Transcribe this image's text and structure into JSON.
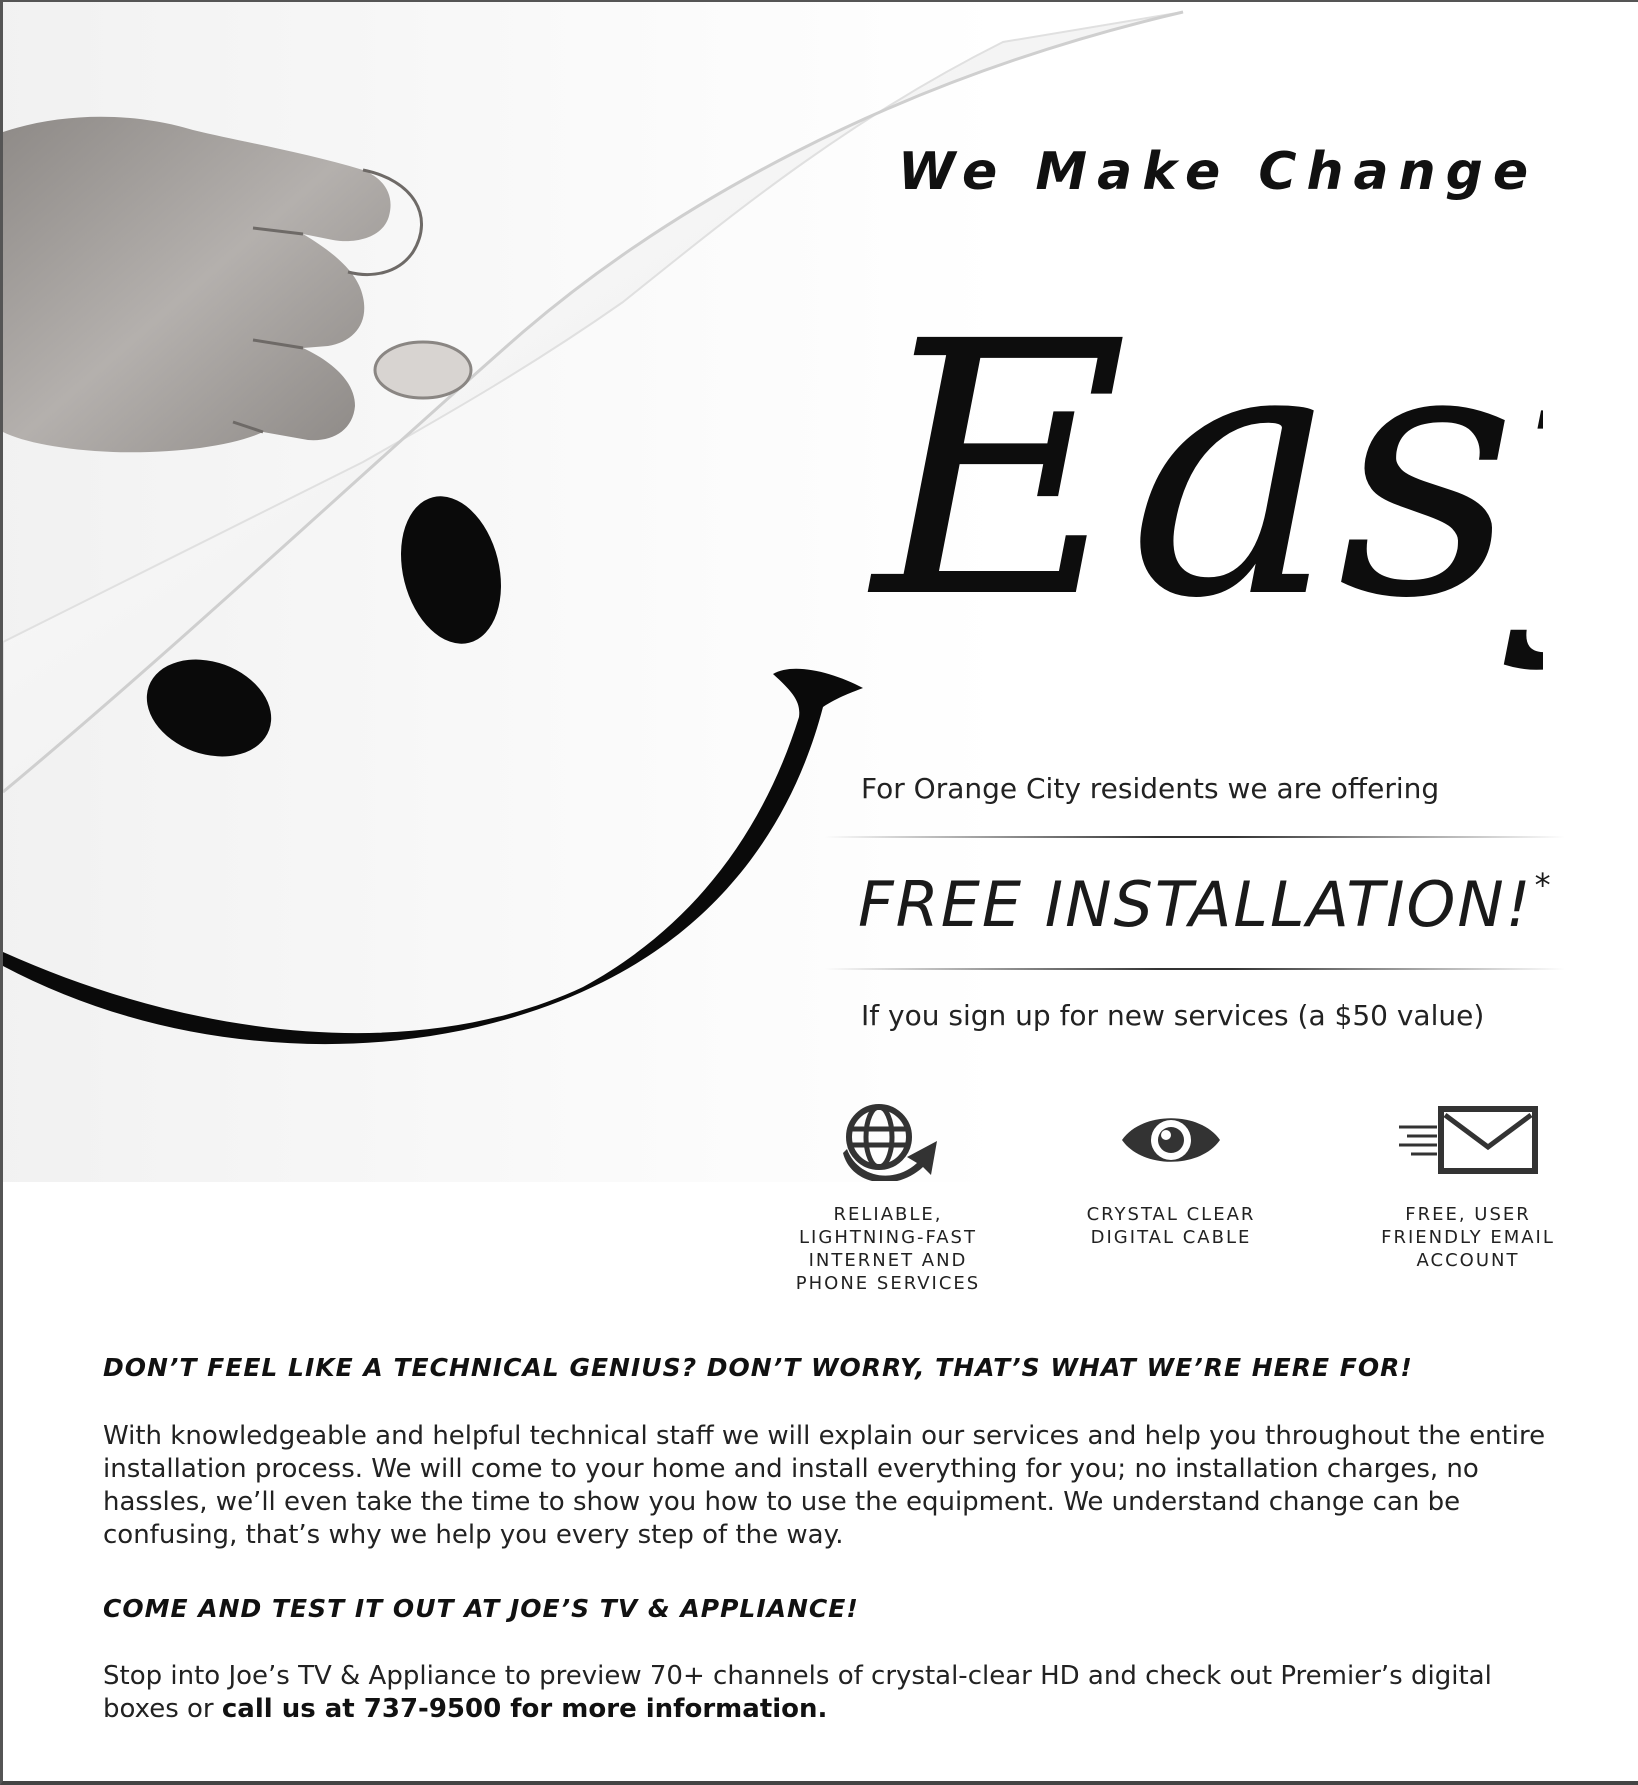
{
  "headline": "We Make Change",
  "hero_word": "Easy",
  "offer": {
    "intro": "For Orange City residents we are offering",
    "main": "FREE INSTALLATION!",
    "asterisk": "*",
    "condition": "If you sign up for new services (a $50 value)"
  },
  "features": [
    {
      "icon": "globe-arrow-icon",
      "caption": "RELIABLE, LIGHTNING-FAST INTERNET AND PHONE SERVICES"
    },
    {
      "icon": "eye-icon",
      "caption": "CRYSTAL CLEAR DIGITAL CABLE"
    },
    {
      "icon": "email-envelope-icon",
      "caption": "FREE, USER FRIENDLY EMAIL ACCOUNT"
    }
  ],
  "section1": {
    "heading": "DON’T FEEL LIKE A TECHNICAL GENIUS? DON’T WORRY, THAT’S WHAT WE’RE HERE FOR!",
    "body": "With knowledgeable and helpful technical staff we will explain our services and help you throughout the entire installation process. We will come to your home and install everything for you; no installation charges, no hassles, we’ll even take the time to show you how to use the equipment. We understand change can be confusing, that’s why we help you every step of the way."
  },
  "section2": {
    "heading": "COME AND TEST IT OUT AT JOE’S TV & APPLIANCE!",
    "body": "Stop into Joe’s TV & Appliance to preview 70+ channels of crystal-clear HD and check out Premier’s digital boxes or ",
    "body_bold": "call us at 737-9500 for more information."
  }
}
